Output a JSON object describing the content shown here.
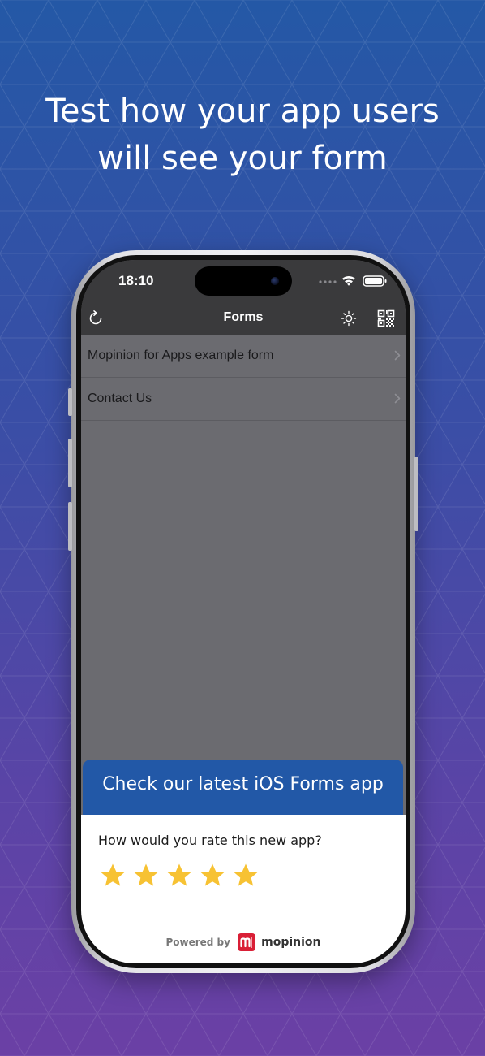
{
  "headline": {
    "line1": "Test how your app users",
    "line2": "will see your form"
  },
  "status_bar": {
    "time": "18:10"
  },
  "nav_bar": {
    "title": "Forms",
    "left_icon": "refresh-icon",
    "right_icons": [
      "brightness-icon",
      "qr-code-icon"
    ]
  },
  "forms_list": [
    {
      "label": "Mopinion for Apps example form"
    },
    {
      "label": "Contact Us"
    }
  ],
  "popup": {
    "title": "Check our latest iOS Forms app",
    "question": "How would you rate this new app?",
    "rating_max": 5,
    "powered_by": "Powered by",
    "brand": "mopinion"
  },
  "colors": {
    "popup_header": "#2258a7",
    "star": "#f7c233",
    "brand_red": "#d91f36",
    "nav_bar": "#3a3a3c",
    "list_background": "#6b6b70"
  }
}
